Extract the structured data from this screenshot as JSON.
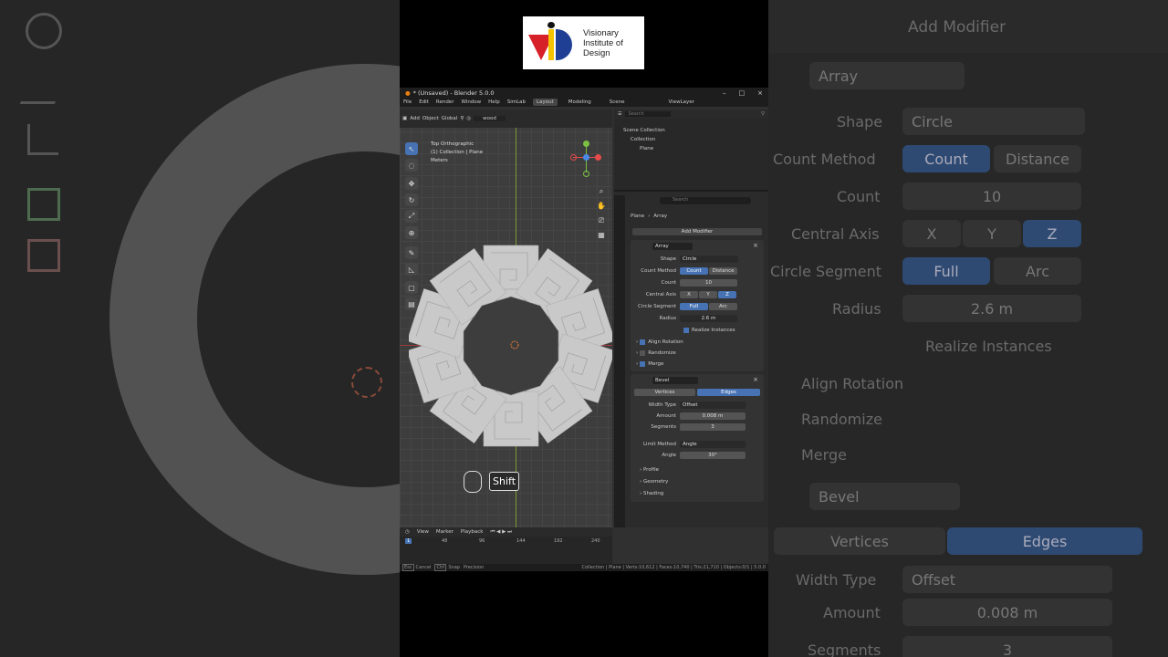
{
  "logo": {
    "line1": "Visionary",
    "line2": "Institute of",
    "line3": "Design"
  },
  "window": {
    "title": "* (Unsaved) - Blender 5.0.0"
  },
  "menu": [
    "File",
    "Edit",
    "Render",
    "Window",
    "Help",
    "SimLab"
  ],
  "workspace_tabs": [
    "Layout",
    "Modeling"
  ],
  "scene": {
    "scene_name": "Scene",
    "view_layer": "ViewLayer",
    "search_placeholder": "Search"
  },
  "viewport": {
    "header": {
      "add": "Add",
      "object": "Object",
      "orientation": "Global",
      "search_value": "wood"
    },
    "info_line1": "Top Orthographic",
    "info_line2": "(1) Collection | Plane",
    "info_line3": "Meters",
    "key_hint": "Shift"
  },
  "outliner": {
    "scene_collection": "Scene Collection",
    "collection": "Collection",
    "object": "Plane"
  },
  "properties": {
    "search_placeholder": "Search",
    "breadcrumb": {
      "object": "Plane",
      "modifier": "Array"
    },
    "add_modifier": "Add Modifier",
    "array": {
      "name": "Array",
      "shape_label": "Shape",
      "shape_value": "Circle",
      "count_method_label": "Count Method",
      "count_method_a": "Count",
      "count_method_b": "Distance",
      "count_label": "Count",
      "count_value": "10",
      "central_axis_label": "Central Axis",
      "axis_x": "X",
      "axis_y": "Y",
      "axis_z": "Z",
      "circle_segment_label": "Circle Segment",
      "seg_full": "Full",
      "seg_arc": "Arc",
      "radius_label": "Radius",
      "radius_value": "2.6 m",
      "realize": "Realize Instances",
      "align_rotation": "Align Rotation",
      "randomize": "Randomize",
      "merge": "Merge"
    },
    "bevel": {
      "name": "Bevel",
      "tab_vertices": "Vertices",
      "tab_edges": "Edges",
      "width_type_label": "Width Type",
      "width_type_value": "Offset",
      "amount_label": "Amount",
      "amount_value": "0.008 m",
      "segments_label": "Segments",
      "segments_value": "3",
      "limit_method_label": "Limit Method",
      "limit_method_value": "Angle",
      "angle_label": "Angle",
      "angle_value": "30°",
      "profile": "Profile",
      "geometry": "Geometry",
      "shading": "Shading"
    }
  },
  "timeline": {
    "view": "View",
    "marker": "Marker",
    "playback": "Playback",
    "frame": "1",
    "ticks": [
      "48",
      "96",
      "144",
      "192",
      "240"
    ]
  },
  "statusbar": {
    "esc": "Esc",
    "cancel": "Cancel",
    "ctrl": "Ctrl",
    "snap": "Snap",
    "precision": "Precision",
    "stats": "Collection | Plane | Verts:10,612 | Faces:10,740 | Tris:21,710 | Objects:0/1 | 5.0.0"
  },
  "colors": {
    "accent": "#4772b3",
    "viewport": "#3d3d3d",
    "panel": "#2b2b2b",
    "mesh": "#c9c9c9"
  }
}
